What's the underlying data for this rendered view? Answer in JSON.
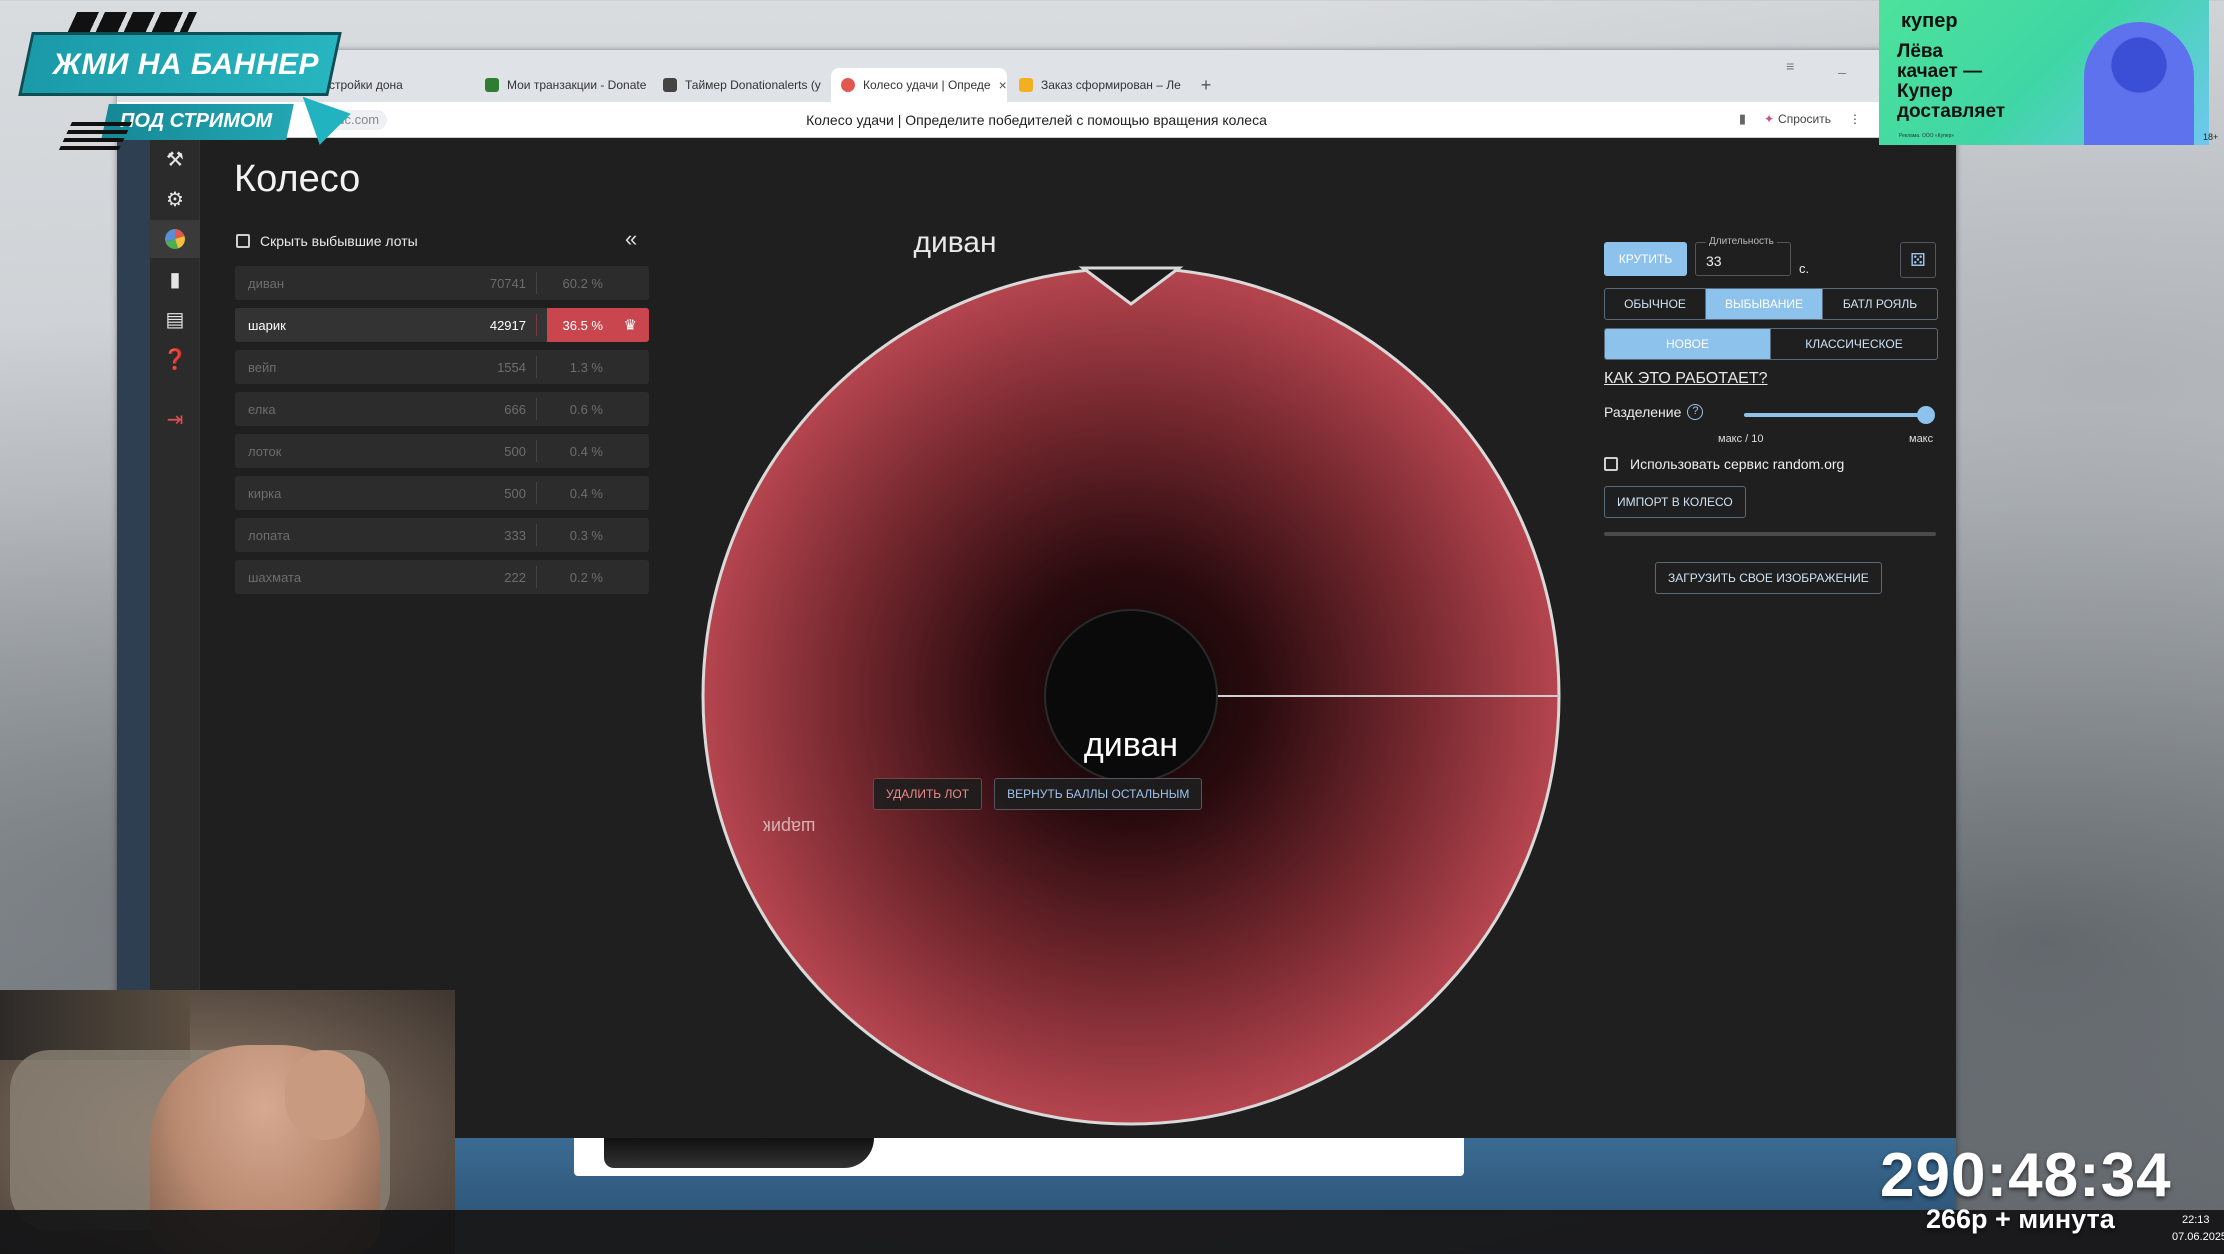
{
  "browser": {
    "tabs": [
      {
        "label": "стройки дона",
        "icon_color": "#f0a020",
        "active": false
      },
      {
        "label": "Мои транзакции - Donatе",
        "icon_color": "#2e7d32",
        "active": false
      },
      {
        "label": "Таймер Donationalerts (y",
        "icon_color": "#444444",
        "active": false
      },
      {
        "label": "Колесо удачи | Опреде",
        "icon_color": "#e0584f",
        "active": true
      },
      {
        "label": "Заказ сформирован – Ле",
        "icon_color": "#f2b01e",
        "active": false
      }
    ],
    "tab_close": "×",
    "new_tab": "+",
    "url": "auc.com",
    "page_title": "Колесо удачи | Определите победителей с помощью вращения колеса",
    "ask_label": "Спросить",
    "menu_glyph": "⋮"
  },
  "nav": {
    "items": [
      "auction-hammer",
      "settings",
      "wheel",
      "stats",
      "clipboard",
      "help",
      "logout"
    ]
  },
  "app": {
    "title": "Колесо",
    "hide_eliminated": "Скрыть выбывшие лоты",
    "collapse_glyph": "«",
    "lots": [
      {
        "name": "диван",
        "amount": "70741",
        "pct": "60.2 %",
        "eliminated": true
      },
      {
        "name": "шарик",
        "amount": "42917",
        "pct": "36.5 %",
        "eliminated": false,
        "winner": true
      },
      {
        "name": "вейп",
        "amount": "1554",
        "pct": "1.3 %",
        "eliminated": true
      },
      {
        "name": "елка",
        "amount": "666",
        "pct": "0.6 %",
        "eliminated": true
      },
      {
        "name": "лоток",
        "amount": "500",
        "pct": "0.4 %",
        "eliminated": true
      },
      {
        "name": "кирка",
        "amount": "500",
        "pct": "0.4 %",
        "eliminated": true
      },
      {
        "name": "лопата",
        "amount": "333",
        "pct": "0.3 %",
        "eliminated": true
      },
      {
        "name": "шахмата",
        "amount": "222",
        "pct": "0.2 %",
        "eliminated": true
      }
    ]
  },
  "wheel": {
    "top_label": "диван",
    "center_label": "диван",
    "slice_label": "шарик",
    "delete_btn": "УДАЛИТЬ ЛОТ",
    "return_btn": "ВЕРНУТЬ БАЛЛЫ ОСТАЛЬНЫМ",
    "color": "#b5454f"
  },
  "controls": {
    "spin": "КРУТИТЬ",
    "duration_label": "Длительность",
    "duration_value": "33",
    "duration_unit": "с.",
    "mode_options": [
      {
        "label": "ОБЫЧНОЕ",
        "on": false
      },
      {
        "label": "ВЫБЫВАНИЕ",
        "on": true
      },
      {
        "label": "БАТЛ РОЯЛЬ",
        "on": false
      }
    ],
    "type_options": [
      {
        "label": "НОВОЕ",
        "on": true
      },
      {
        "label": "КЛАССИЧЕСКОЕ",
        "on": false
      }
    ],
    "how_it_works": "КАК ЭТО РАБОТАЕТ?",
    "split_label": "Разделение",
    "help_glyph": "?",
    "split_min": "макс / 10",
    "split_max": "макс",
    "split_level": 1.0,
    "use_random_org": "Использовать сервис random.org",
    "import_btn": "ИМПОРТ В КОЛЕСО",
    "upload_btn": "ЗАГРУЗИТЬ СВОЕ ИЗОБРАЖЕНИЕ"
  },
  "overlay": {
    "banner_main": "ЖМИ НА БАННЕР",
    "banner_sub": "ПОД СТРИМОМ",
    "ad_logo": "купер",
    "ad_text": "Лёва\nкачает —\nКупер\nдоставляет",
    "ad_fine": "Реклама. ООО «Купер»",
    "ad_corner": "18+",
    "timer": "290:48:34",
    "rate": "266р + минута",
    "clock_time": "22:13",
    "clock_date": "07.06.2025"
  },
  "colors": {
    "accent": "#8cc2ec",
    "winner_accent": "#c9464f",
    "danger": "#e05050"
  }
}
